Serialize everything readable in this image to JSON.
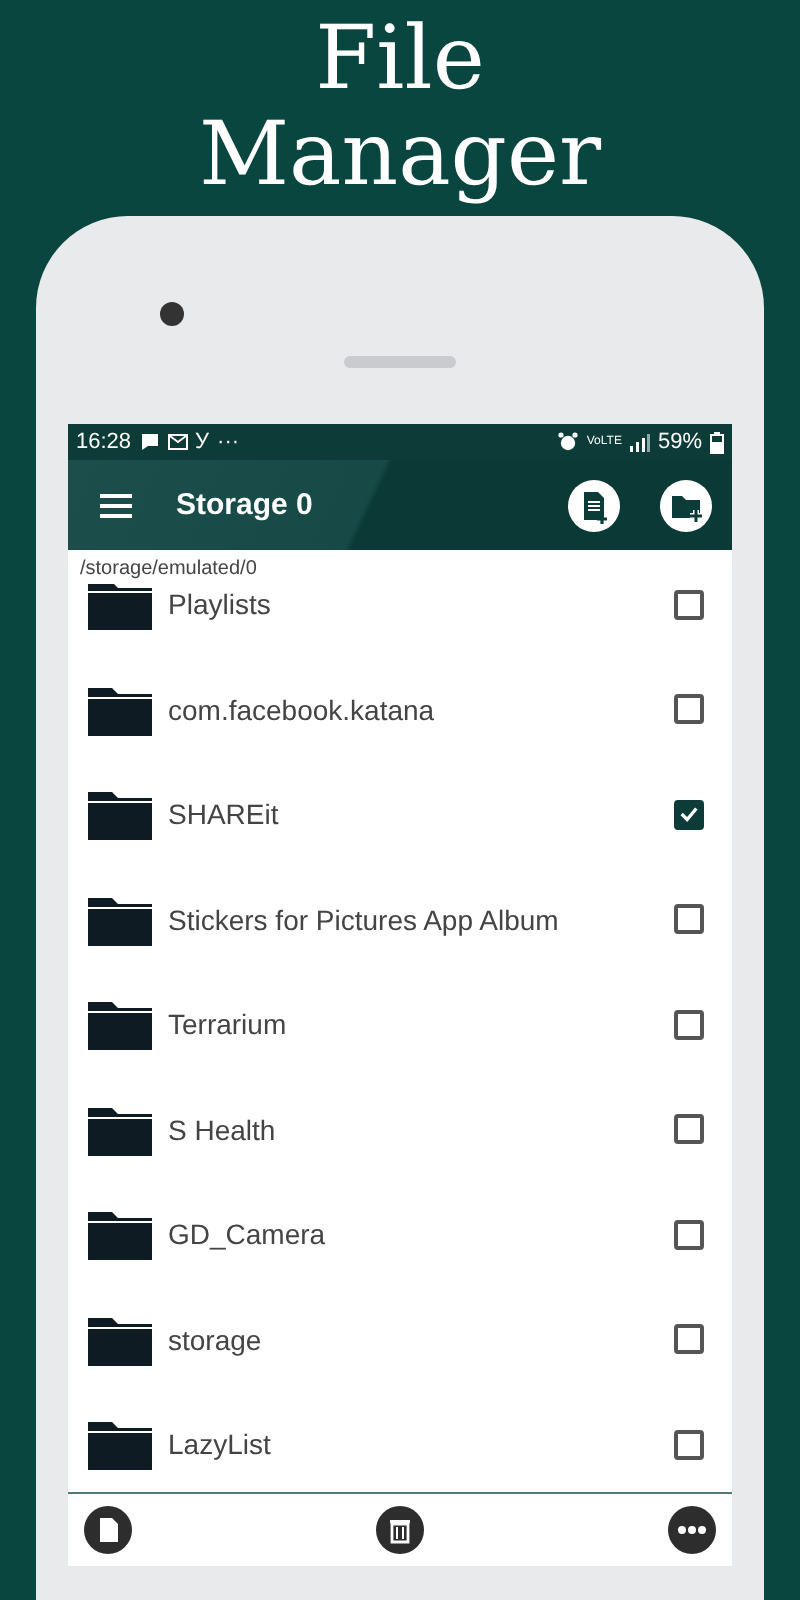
{
  "headline": [
    "File",
    "Manager"
  ],
  "status_bar": {
    "time": "16:28",
    "app_mark": "У",
    "more": "···",
    "network": "VoLTE",
    "battery": "59%"
  },
  "app_bar": {
    "title": "Storage 0"
  },
  "path": "/storage/emulated/0",
  "folders": [
    {
      "name": "Playlists",
      "checked": false
    },
    {
      "name": "com.facebook.katana",
      "checked": false
    },
    {
      "name": "SHAREit",
      "checked": true
    },
    {
      "name": "Stickers for Pictures App Album",
      "checked": false
    },
    {
      "name": "Terrarium",
      "checked": false
    },
    {
      "name": "S Health",
      "checked": false
    },
    {
      "name": "GD_Camera",
      "checked": false
    },
    {
      "name": "storage",
      "checked": false
    },
    {
      "name": "LazyList",
      "checked": false
    }
  ]
}
